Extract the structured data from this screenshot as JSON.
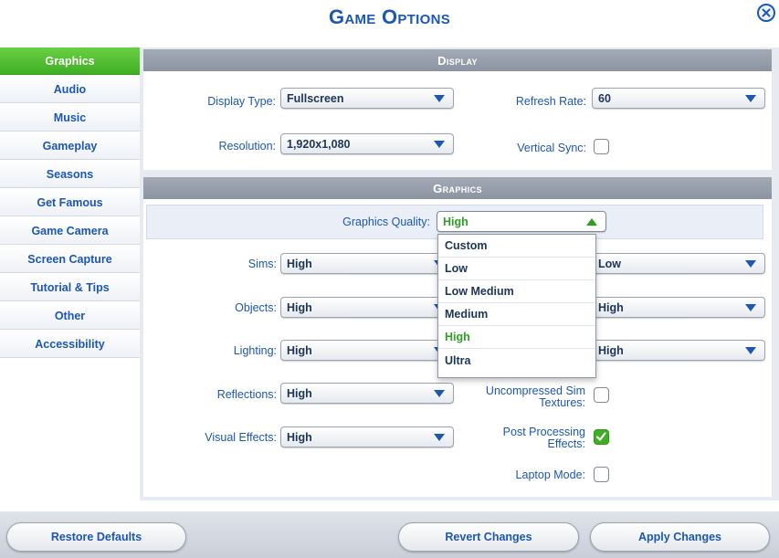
{
  "header": {
    "title": "Game Options"
  },
  "sidebar": {
    "items": [
      {
        "label": "Graphics",
        "active": true
      },
      {
        "label": "Audio"
      },
      {
        "label": "Music"
      },
      {
        "label": "Gameplay"
      },
      {
        "label": "Seasons"
      },
      {
        "label": "Get Famous"
      },
      {
        "label": "Game Camera"
      },
      {
        "label": "Screen Capture"
      },
      {
        "label": "Tutorial & Tips"
      },
      {
        "label": "Other"
      },
      {
        "label": "Accessibility"
      }
    ]
  },
  "display": {
    "heading": "Display",
    "display_type": {
      "label": "Display Type:",
      "value": "Fullscreen"
    },
    "refresh_rate": {
      "label": "Refresh Rate:",
      "value": "60"
    },
    "resolution": {
      "label": "Resolution:",
      "value": "1,920x1,080"
    },
    "vertical_sync": {
      "label": "Vertical Sync:",
      "checked": false
    }
  },
  "graphics": {
    "heading": "Graphics",
    "quality": {
      "label": "Graphics Quality:",
      "value": "High"
    },
    "quality_options": [
      "Custom",
      "Low",
      "Low Medium",
      "Medium",
      "High",
      "Ultra"
    ],
    "sims": {
      "label": "Sims:",
      "value": "High"
    },
    "objects": {
      "label": "Objects:",
      "value": "High"
    },
    "lighting": {
      "label": "Lighting:",
      "value": "High"
    },
    "reflections": {
      "label": "Reflections:",
      "value": "High"
    },
    "visual_effects": {
      "label": "Visual Effects:",
      "value": "High"
    },
    "right_dd1": {
      "value": "Low"
    },
    "right_dd2": {
      "value": "High"
    },
    "right_dd3": {
      "value": "High"
    },
    "uncompressed": {
      "label_line1": "Uncompressed Sim",
      "label_line2": "Textures:",
      "checked": false
    },
    "post_processing": {
      "label_line1": "Post Processing",
      "label_line2": "Effects:",
      "checked": true
    },
    "laptop_mode": {
      "label": "Laptop Mode:",
      "checked": false
    }
  },
  "footer": {
    "restore_label": "Restore Defaults",
    "revert_label": "Revert Changes",
    "apply_label": "Apply Changes"
  },
  "colors": {
    "accent_blue": "#1c57b4",
    "active_green": "#3fae24",
    "selected_text_green": "#2f9e25"
  }
}
